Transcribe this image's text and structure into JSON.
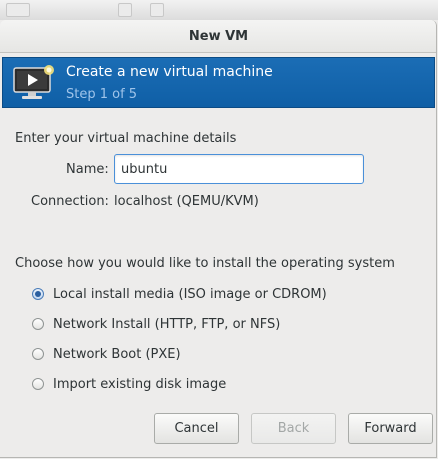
{
  "window": {
    "title": "New VM"
  },
  "banner": {
    "title": "Create a new virtual machine",
    "step": "Step 1 of 5",
    "icon": "monitor-play-icon"
  },
  "details": {
    "heading": "Enter your virtual machine details",
    "name_label": "Name:",
    "name_value": "ubuntu",
    "connection_label": "Connection:",
    "connection_value": "localhost (QEMU/KVM)"
  },
  "install": {
    "heading": "Choose how you would like to install the operating system",
    "options": [
      {
        "label": "Local install media (ISO image or CDROM)",
        "selected": true
      },
      {
        "label": "Network Install (HTTP, FTP, or NFS)",
        "selected": false
      },
      {
        "label": "Network Boot (PXE)",
        "selected": false
      },
      {
        "label": "Import existing disk image",
        "selected": false
      }
    ]
  },
  "buttons": {
    "cancel": "Cancel",
    "back": "Back",
    "forward": "Forward",
    "back_enabled": false
  },
  "colors": {
    "banner": "#1565ad",
    "focus": "#4a90d9",
    "background": "#edeceb"
  }
}
